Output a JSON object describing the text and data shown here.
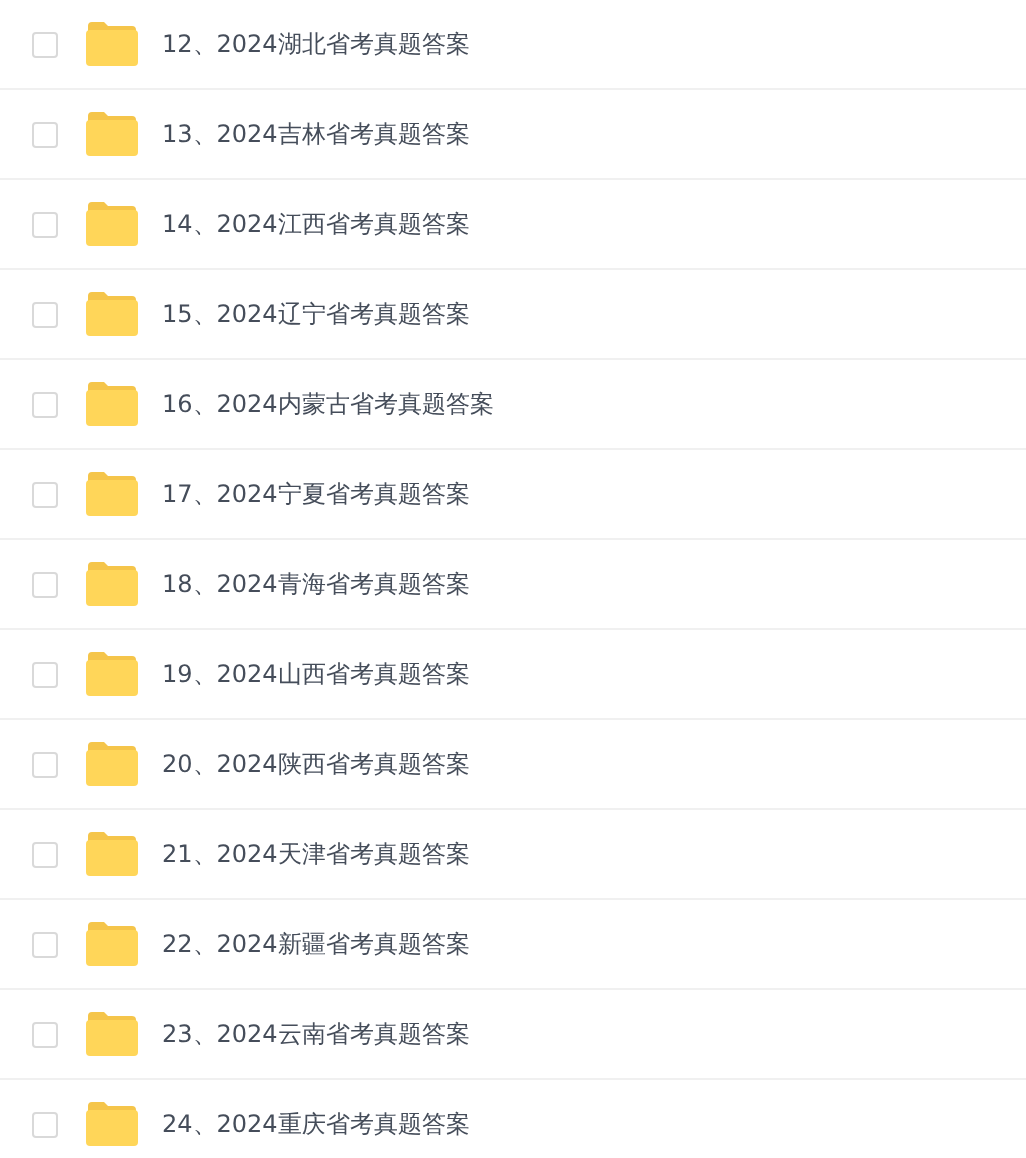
{
  "files": [
    {
      "name": "12、2024湖北省考真题答案",
      "checked": false
    },
    {
      "name": "13、2024吉林省考真题答案",
      "checked": false
    },
    {
      "name": "14、2024江西省考真题答案",
      "checked": false
    },
    {
      "name": "15、2024辽宁省考真题答案",
      "checked": false
    },
    {
      "name": "16、2024内蒙古省考真题答案",
      "checked": false
    },
    {
      "name": "17、2024宁夏省考真题答案",
      "checked": false
    },
    {
      "name": "18、2024青海省考真题答案",
      "checked": false
    },
    {
      "name": "19、2024山西省考真题答案",
      "checked": false
    },
    {
      "name": "20、2024陕西省考真题答案",
      "checked": false
    },
    {
      "name": "21、2024天津省考真题答案",
      "checked": false
    },
    {
      "name": "22、2024新疆省考真题答案",
      "checked": false
    },
    {
      "name": "23、2024云南省考真题答案",
      "checked": false
    },
    {
      "name": "24、2024重庆省考真题答案",
      "checked": false
    }
  ]
}
